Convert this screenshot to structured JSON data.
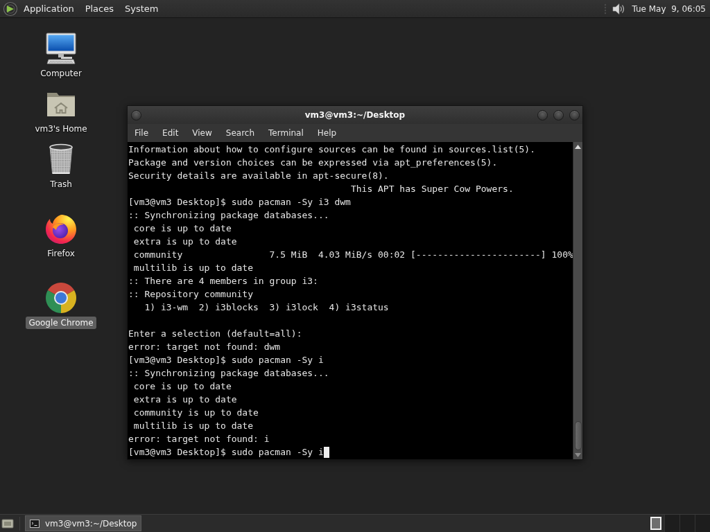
{
  "top_panel": {
    "menus": [
      "Application",
      "Places",
      "System"
    ],
    "clock": "Tue May  9, 06:05"
  },
  "desktop_icons": [
    {
      "kind": "computer",
      "label": "Computer",
      "selected": false
    },
    {
      "kind": "home",
      "label": "vm3's Home",
      "selected": false
    },
    {
      "kind": "trash",
      "label": "Trash",
      "selected": false
    },
    {
      "kind": "firefox",
      "label": "Firefox",
      "selected": false
    },
    {
      "kind": "chrome",
      "label": "Google Chrome",
      "selected": true
    }
  ],
  "terminal": {
    "title": "vm3@vm3:~/Desktop",
    "menu": [
      "File",
      "Edit",
      "View",
      "Search",
      "Terminal",
      "Help"
    ],
    "lines": [
      {
        "kind": "text",
        "text": "Information about how to configure sources can be found in sources.list(5)."
      },
      {
        "kind": "text",
        "text": "Package and version choices can be expressed via apt_preferences(5)."
      },
      {
        "kind": "text",
        "text": "Security details are available in apt-secure(8)."
      },
      {
        "kind": "text",
        "text": "                                         This APT has Super Cow Powers."
      },
      {
        "kind": "text",
        "text": "[vm3@vm3 Desktop]$ sudo pacman -Sy i3 dwm"
      },
      {
        "kind": "text",
        "text": ":: Synchronizing package databases..."
      },
      {
        "kind": "text",
        "text": " core is up to date"
      },
      {
        "kind": "text",
        "text": " extra is up to date"
      },
      {
        "kind": "text",
        "text": " community                7.5 MiB  4.03 MiB/s 00:02 [-----------------------] 100%"
      },
      {
        "kind": "text",
        "text": " multilib is up to date"
      },
      {
        "kind": "text",
        "text": ":: There are 4 members in group i3:"
      },
      {
        "kind": "text",
        "text": ":: Repository community"
      },
      {
        "kind": "text",
        "text": "   1) i3-wm  2) i3blocks  3) i3lock  4) i3status"
      },
      {
        "kind": "blank"
      },
      {
        "kind": "text",
        "text": "Enter a selection (default=all):"
      },
      {
        "kind": "text",
        "text": "error: target not found: dwm"
      },
      {
        "kind": "text",
        "text": "[vm3@vm3 Desktop]$ sudo pacman -Sy i"
      },
      {
        "kind": "text",
        "text": ":: Synchronizing package databases..."
      },
      {
        "kind": "text",
        "text": " core is up to date"
      },
      {
        "kind": "text",
        "text": " extra is up to date"
      },
      {
        "kind": "text",
        "text": " community is up to date"
      },
      {
        "kind": "text",
        "text": " multilib is up to date"
      },
      {
        "kind": "text",
        "text": "error: target not found: i"
      },
      {
        "kind": "text",
        "text": "[vm3@vm3 Desktop]$ sudo pacman -Sy i"
      }
    ],
    "cursor": true
  },
  "bottom_panel": {
    "tasks": [
      {
        "label": "vm3@vm3:~/Desktop",
        "selected": true
      }
    ],
    "workspaces": [
      {
        "selected": true
      },
      {
        "selected": false
      },
      {
        "selected": false
      },
      {
        "selected": false
      }
    ]
  }
}
